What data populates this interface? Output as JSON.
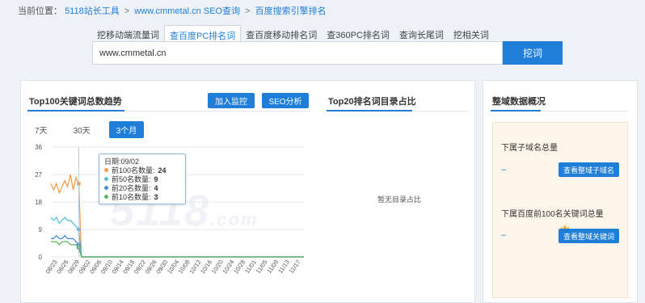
{
  "breadcrumb": {
    "prefix": "当前位置：",
    "items": [
      "5118站长工具",
      "www.cmmetal.cn SEO查询",
      "百度搜索引擎排名"
    ],
    "separator": ">"
  },
  "tabs": [
    "挖移动端流量词",
    "查百度PC排名词",
    "查百度移动排名词",
    "查360PC排名词",
    "查询长尾词",
    "挖相关词"
  ],
  "active_tab": 1,
  "search": {
    "value": "www.cmmetal.cn",
    "button": "挖词"
  },
  "trend": {
    "title": "Top100关键词总数趋势",
    "btn_monitor": "加入监控",
    "btn_seo": "SEO分析",
    "ranges": [
      "7天",
      "30天",
      "3个月"
    ],
    "active_range": 2
  },
  "tooltip": {
    "date": "日期:09/02",
    "rows": [
      {
        "label": "前100名数量:",
        "value": "24",
        "color": "#f0a04b"
      },
      {
        "label": "前50名数量:",
        "value": "9",
        "color": "#5bc0de"
      },
      {
        "label": "前20名数量:",
        "value": "4",
        "color": "#4a90d9"
      },
      {
        "label": "前10名数量:",
        "value": "3",
        "color": "#5cb85c"
      }
    ]
  },
  "top20": {
    "title": "Top20排名词目录占比",
    "empty": "暂无目录占比"
  },
  "side": {
    "title": "整域数据概况",
    "sub_label": "下属子域名总量",
    "sub_value": "–",
    "sub_btn": "查看整域子域名",
    "kw_label": "下属百度前100名关键词总量",
    "kw_value": "–",
    "kw_btn": "查看整域关键词"
  },
  "watermark": {
    "main": "5118",
    "suffix": ".com"
  },
  "chart_data": {
    "type": "line",
    "ylim": [
      0,
      36
    ],
    "yticks": [
      "36",
      "27",
      "18",
      "9",
      "0"
    ],
    "x": [
      "08/23",
      "08/26",
      "08/29",
      "09/02",
      "09/06",
      "09/10",
      "09/14",
      "09/18",
      "09/22",
      "09/26",
      "09/30",
      "10/04",
      "10/08",
      "10/12",
      "10/16",
      "10/20",
      "10/24",
      "10/28",
      "11/01",
      "11/05",
      "11/09",
      "11/13",
      "11/17"
    ],
    "series": [
      {
        "name": "前100名数量",
        "color": "#f0a04b",
        "values": [
          24,
          22,
          24,
          21,
          23,
          25,
          23,
          27,
          22,
          26,
          24,
          0,
          0,
          0,
          0,
          0,
          0,
          0,
          0,
          0,
          0,
          0,
          0,
          0,
          0,
          0,
          0,
          0,
          0,
          0,
          0,
          0,
          0,
          0,
          0,
          0,
          0,
          0,
          0,
          0,
          0,
          0,
          0,
          0,
          0,
          0,
          0,
          0,
          0,
          0,
          0,
          0,
          0,
          0,
          0,
          0,
          0,
          0,
          0,
          0,
          0,
          0,
          0,
          0,
          0,
          0,
          0,
          0,
          0,
          0,
          0,
          0,
          0,
          0,
          0,
          0,
          0,
          0,
          0,
          0,
          0,
          0,
          0,
          0,
          0,
          0,
          0,
          0,
          0,
          0,
          0,
          0
        ]
      },
      {
        "name": "前50名数量",
        "color": "#5bc0de",
        "values": [
          13,
          12,
          13,
          11,
          12,
          13,
          12,
          12,
          11,
          10,
          9,
          0,
          0,
          0,
          0,
          0,
          0,
          0,
          0,
          0,
          0,
          0,
          0,
          0,
          0,
          0,
          0,
          0,
          0,
          0,
          0,
          0,
          0,
          0,
          0,
          0,
          0,
          0,
          0,
          0,
          0,
          0,
          0,
          0,
          0,
          0,
          0,
          0,
          0,
          0,
          0,
          0,
          0,
          0,
          0,
          0,
          0,
          0,
          0,
          0,
          0,
          0,
          0,
          0,
          0,
          0,
          0,
          0,
          0,
          0,
          0,
          0,
          0,
          0,
          0,
          0,
          0,
          0,
          0,
          0,
          0,
          0,
          0,
          0,
          0,
          0,
          0,
          0,
          0,
          0,
          0,
          0
        ]
      },
      {
        "name": "前20名数量",
        "color": "#4a90d9",
        "values": [
          6,
          6,
          7,
          6,
          6,
          7,
          6,
          6,
          6,
          5,
          4,
          0,
          0,
          0,
          0,
          0,
          0,
          0,
          0,
          0,
          0,
          0,
          0,
          0,
          0,
          0,
          0,
          0,
          0,
          0,
          0,
          0,
          0,
          0,
          0,
          0,
          0,
          0,
          0,
          0,
          0,
          0,
          0,
          0,
          0,
          0,
          0,
          0,
          0,
          0,
          0,
          0,
          0,
          0,
          0,
          0,
          0,
          0,
          0,
          0,
          0,
          0,
          0,
          0,
          0,
          0,
          0,
          0,
          0,
          0,
          0,
          0,
          0,
          0,
          0,
          0,
          0,
          0,
          0,
          0,
          0,
          0,
          0,
          0,
          0,
          0,
          0,
          0,
          0,
          0,
          0,
          0
        ]
      },
      {
        "name": "前10名数量",
        "color": "#5cb85c",
        "values": [
          5,
          5,
          5,
          4,
          5,
          5,
          5,
          4,
          4,
          4,
          3,
          0,
          0,
          0,
          0,
          0,
          0,
          0,
          0,
          0,
          0,
          0,
          0,
          0,
          0,
          0,
          0,
          0,
          0,
          0,
          0,
          0,
          0,
          0,
          0,
          0,
          0,
          0,
          0,
          0,
          0,
          0,
          0,
          0,
          0,
          0,
          0,
          0,
          0,
          0,
          0,
          0,
          0,
          0,
          0,
          0,
          0,
          0,
          0,
          0,
          0,
          0,
          0,
          0,
          0,
          0,
          0,
          0,
          0,
          0,
          0,
          0,
          0,
          0,
          0,
          0,
          0,
          0,
          0,
          0,
          0,
          0,
          0,
          0,
          0,
          0,
          0,
          0,
          0,
          0,
          0,
          0
        ]
      }
    ]
  }
}
